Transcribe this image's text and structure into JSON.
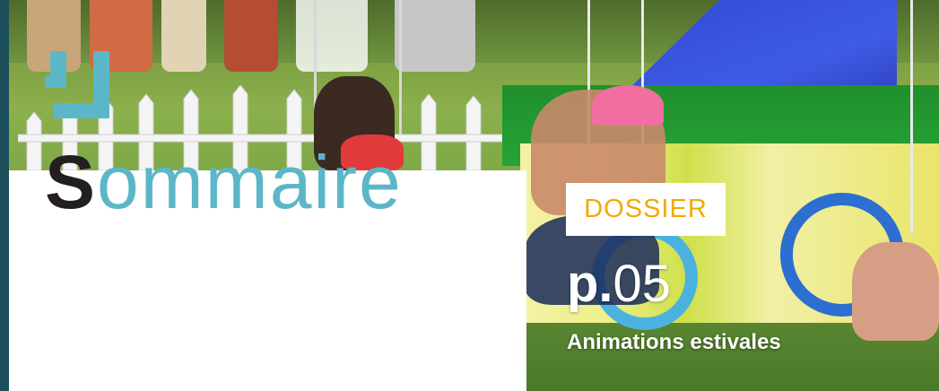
{
  "header": {
    "title_initial": "S",
    "title_rest": "ommaire"
  },
  "feature": {
    "badge": "DOSSIER",
    "page_prefix": "p.",
    "page_number": "05",
    "subtitle": "Animations estivales"
  },
  "colors": {
    "accent": "#5bb7c8",
    "title_initial": "#231f20",
    "badge_text": "#f2a900",
    "edge": "#1d4f5c"
  }
}
